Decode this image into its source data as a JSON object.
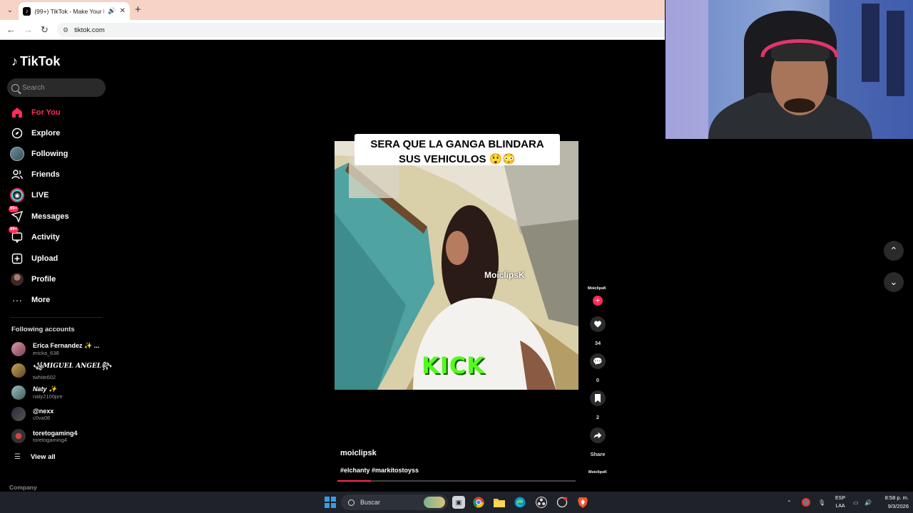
{
  "browser": {
    "tab_title": "(99+) TikTok - Make Your Day",
    "tab_audio_icon": "speaker-icon",
    "url": "tiktok.com"
  },
  "tiktok": {
    "logo_text": "TikTok",
    "search_placeholder": "Search",
    "nav": [
      {
        "label": "For You",
        "icon": "home-icon",
        "active": true
      },
      {
        "label": "Explore",
        "icon": "compass-icon"
      },
      {
        "label": "Following",
        "icon": "following-avatar-icon"
      },
      {
        "label": "Friends",
        "icon": "friends-icon"
      },
      {
        "label": "LIVE",
        "icon": "live-icon"
      },
      {
        "label": "Messages",
        "icon": "messages-icon",
        "badge": "99+"
      },
      {
        "label": "Activity",
        "icon": "activity-icon",
        "badge": "99+"
      },
      {
        "label": "Upload",
        "icon": "upload-icon"
      },
      {
        "label": "Profile",
        "icon": "profile-avatar-icon"
      },
      {
        "label": "More",
        "icon": "more-icon"
      }
    ],
    "following_title": "Following accounts",
    "accounts": [
      {
        "name": "Erica Fernandez ✨ ...",
        "handle": "ericka_638"
      },
      {
        "name": "꧁MIGUEL ANGEL꧂",
        "handle": "twhite602"
      },
      {
        "name": "Naty ✨",
        "handle": "naty2100pre"
      },
      {
        "name": "@nexx",
        "handle": "c0va08"
      },
      {
        "name": "toretogaming4",
        "handle": "toretogaming4"
      }
    ],
    "view_all": "View all",
    "company": "Company"
  },
  "video": {
    "caption_line1": "SERA QUE LA GANGA BLINDARA",
    "caption_line2": "SUS VEHICULOS 😲😳",
    "watermark": "MoiclipsK",
    "kick_overlay": "KICK",
    "username": "moiclipsk",
    "hashtags": "#elchanty #markitostoyss",
    "progress": 0.14
  },
  "actions": {
    "creator": "MoiclipsK",
    "likes": "34",
    "comments": "0",
    "saves": "2",
    "share": "Share"
  },
  "taskbar": {
    "search_label": "Buscar",
    "lang_line1": "ESP",
    "lang_line2": "LAA",
    "time": "8:58 p. m.",
    "date": "9/3/2026"
  }
}
